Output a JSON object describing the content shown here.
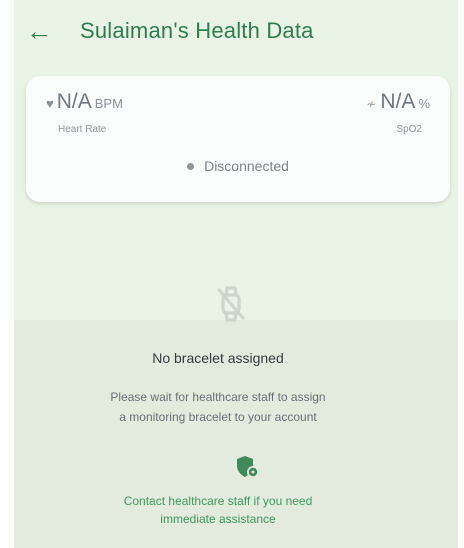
{
  "header": {
    "back_icon": "arrow-left-icon",
    "title": "Sulaiman's Health Data"
  },
  "vitals": {
    "heart_rate": {
      "value": "N/A",
      "unit": "BPM",
      "label": "Heart Rate",
      "icon": "heart-icon"
    },
    "spo2": {
      "value": "N/A",
      "unit": "%",
      "label": "SpO2",
      "icon": "pulse-icon"
    },
    "status": "Disconnected"
  },
  "empty_state": {
    "icon": "watch-off-icon",
    "title": "No bracelet assigned",
    "description_line1": "Please wait for healthcare staff to assign",
    "description_line2": "a monitoring bracelet to your account",
    "help_icon": "shield-icon",
    "contact_line1": "Contact healthcare staff if you need",
    "contact_line2": "immediate assistance"
  },
  "colors": {
    "accent": "#2e7d4b",
    "background": "#eaf4e6"
  }
}
